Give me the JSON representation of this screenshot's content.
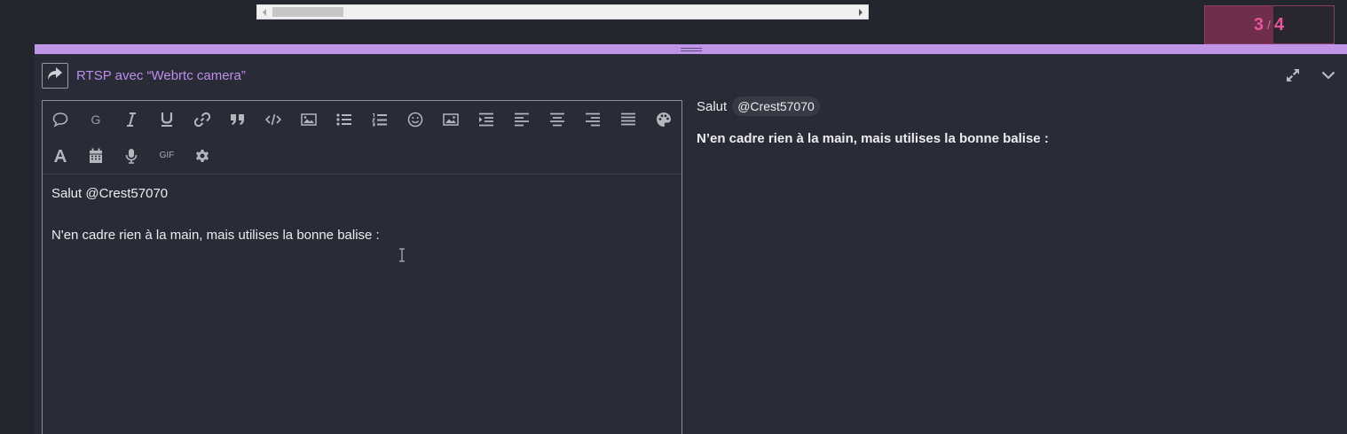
{
  "scrollbar": {},
  "progress": {
    "current": "3",
    "separator": "/",
    "total": "4",
    "fill_fraction": 0.53
  },
  "composer": {
    "title": "RTSP avec “Webrtc camera”",
    "reply_icon": "share-arrow-icon",
    "actions": {
      "fullscreen_icon": "expand-icon",
      "collapse_icon": "chevron-down-icon"
    }
  },
  "toolbar": {
    "row1": [
      {
        "name": "speech-bubble-icon"
      },
      {
        "name": "bold-g-icon",
        "text": "G"
      },
      {
        "name": "italic-icon"
      },
      {
        "name": "underline-icon"
      },
      {
        "name": "link-icon"
      },
      {
        "name": "quote-icon"
      },
      {
        "name": "code-icon"
      },
      {
        "name": "image-icon"
      },
      {
        "name": "bullet-list-icon"
      },
      {
        "name": "numbered-list-icon"
      },
      {
        "name": "smiley-icon"
      },
      {
        "name": "image-upload-icon"
      },
      {
        "name": "indent-icon"
      },
      {
        "name": "align-left-icon"
      },
      {
        "name": "align-center-icon"
      },
      {
        "name": "align-right-icon"
      },
      {
        "name": "align-justify-icon"
      },
      {
        "name": "palette-icon"
      }
    ],
    "row2": [
      {
        "name": "font-icon"
      },
      {
        "name": "calendar-icon"
      },
      {
        "name": "microphone-icon"
      },
      {
        "name": "gif-icon",
        "text": "GIF"
      },
      {
        "name": "gear-icon"
      }
    ]
  },
  "editor": {
    "line1": "Salut @Crest57070",
    "line2": "N'en cadre rien à la main, mais utilises la bonne balise :"
  },
  "preview": {
    "greeting": "Salut",
    "mention": "@Crest57070",
    "body": "N’en cadre rien à la main, mais utilises la bonne balise :"
  }
}
